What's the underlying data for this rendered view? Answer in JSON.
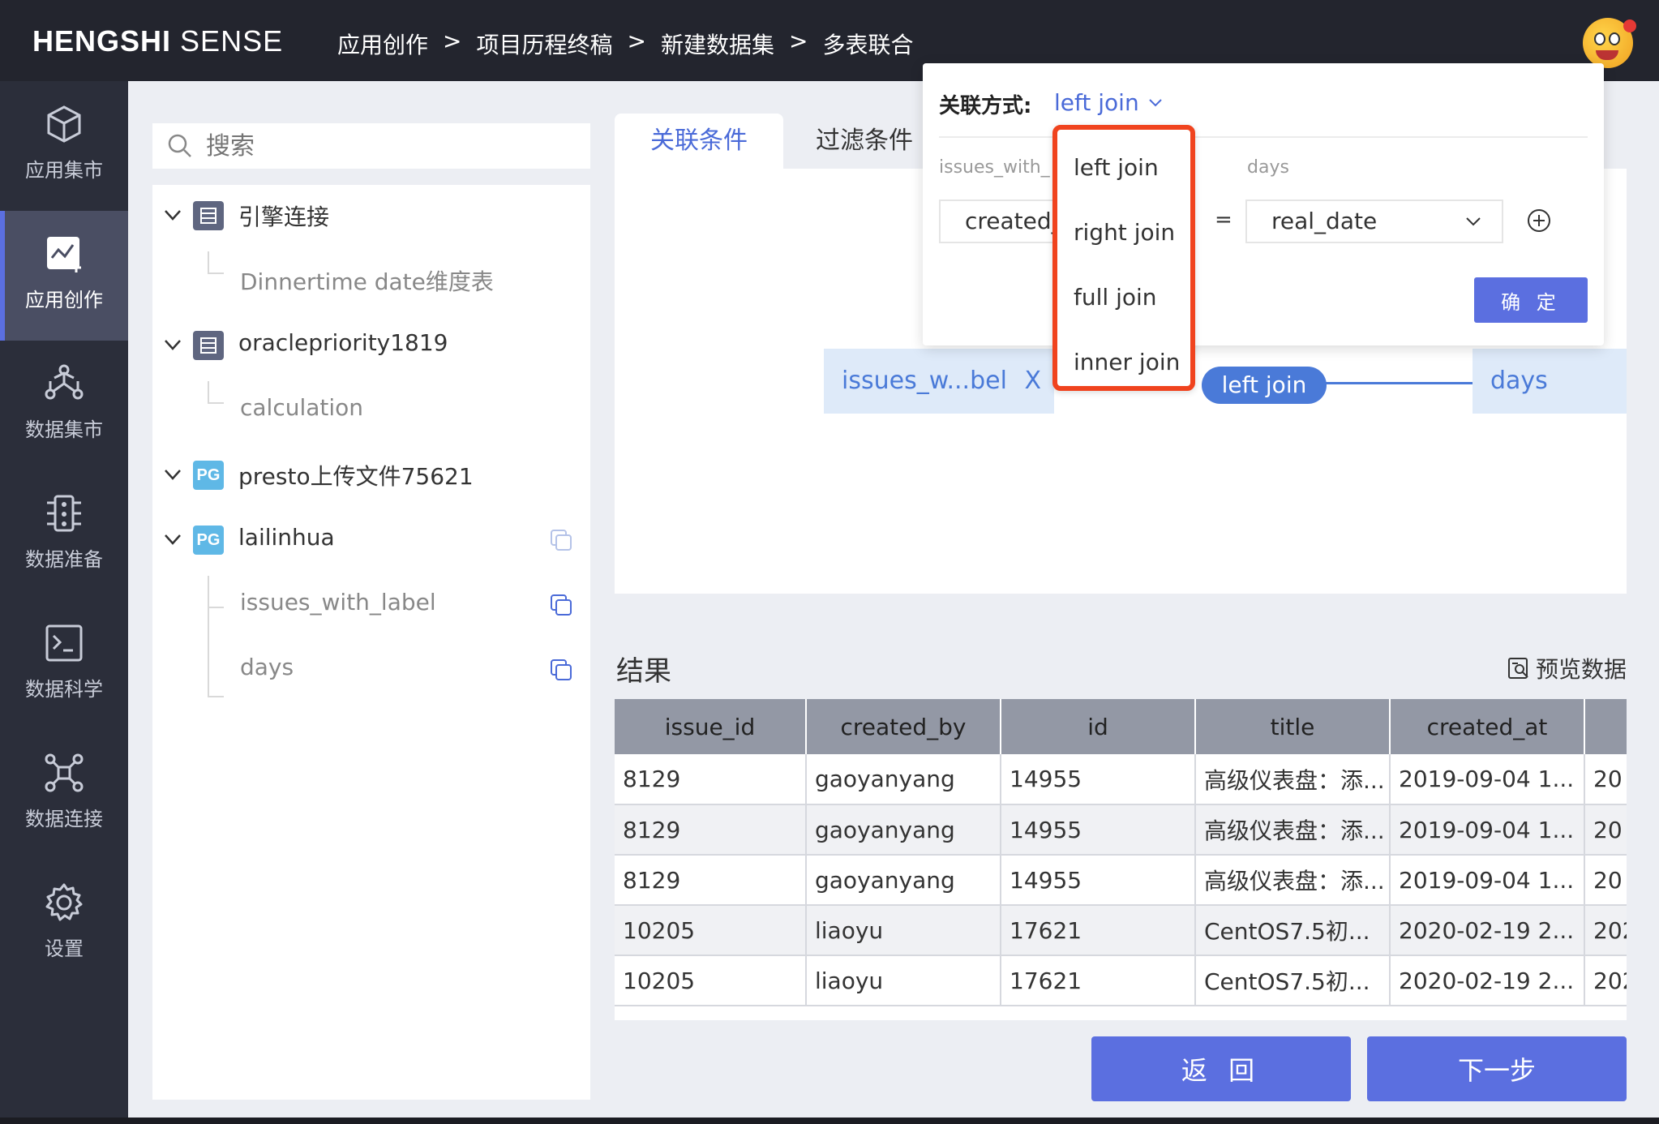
{
  "header": {
    "brand_bold": "HENGSHI",
    "brand_light": "SENSE",
    "breadcrumbs": [
      "应用创作",
      "项目历程终稿",
      "新建数据集",
      "多表联合"
    ],
    "sep": ">"
  },
  "sidebar": {
    "items": [
      {
        "label": "应用集市",
        "icon": "cube-icon"
      },
      {
        "label": "应用创作",
        "icon": "chart-add-icon"
      },
      {
        "label": "数据集市",
        "icon": "network-icon"
      },
      {
        "label": "数据准备",
        "icon": "sliders-icon"
      },
      {
        "label": "数据科学",
        "icon": "terminal-icon"
      },
      {
        "label": "数据连接",
        "icon": "connect-icon"
      },
      {
        "label": "设置",
        "icon": "gear-icon"
      }
    ],
    "active_index": 1
  },
  "search": {
    "placeholder": "搜索"
  },
  "tree": {
    "nodes": [
      {
        "name": "引擎连接",
        "type": "engine"
      },
      {
        "name": "Dinnertime date维度表",
        "type": "child"
      },
      {
        "name": "oraclepriority1819",
        "type": "engine"
      },
      {
        "name": "calculation",
        "type": "child"
      },
      {
        "name": "presto上传文件75621",
        "type": "pg"
      },
      {
        "name": "lailinhua",
        "type": "pg"
      },
      {
        "name": "issues_with_label",
        "type": "child"
      },
      {
        "name": "days",
        "type": "child"
      }
    ],
    "pg_badge": "PG"
  },
  "tabs": {
    "active": "关联条件",
    "inactive": "过滤条件"
  },
  "canvas": {
    "left_node": "issues_w...bel",
    "left_node_close": "X",
    "right_node": "days",
    "join_label": "left join"
  },
  "popover": {
    "label": "关联方式:",
    "join_type": "left join",
    "left_table": "issues_with_",
    "right_table": "days",
    "left_field": "created_",
    "eq": "=",
    "right_field": "real_date",
    "confirm": "确 定"
  },
  "dropdown": {
    "options": [
      "left join",
      "right join",
      "full join",
      "inner join"
    ]
  },
  "results": {
    "title": "结果",
    "preview": "预览数据",
    "columns": [
      "issue_id",
      "created_by",
      "id",
      "title",
      "created_at",
      ""
    ],
    "rows": [
      [
        "8129",
        "gaoyanyang",
        "14955",
        "高级仪表盘：添...",
        "2019-09-04 1...",
        "20"
      ],
      [
        "8129",
        "gaoyanyang",
        "14955",
        "高级仪表盘：添...",
        "2019-09-04 1...",
        "20"
      ],
      [
        "8129",
        "gaoyanyang",
        "14955",
        "高级仪表盘：添...",
        "2019-09-04 1...",
        "20"
      ],
      [
        "10205",
        "liaoyu",
        "17621",
        "CentOS7.5初...",
        "2020-02-19 2...",
        "202"
      ],
      [
        "10205",
        "liaoyu",
        "17621",
        "CentOS7.5初...",
        "2020-02-19 2...",
        "202"
      ]
    ]
  },
  "footer": {
    "back": "返 回",
    "next": "下一步"
  },
  "colors": {
    "accent": "#5b6fe0",
    "link": "#4a6ad8",
    "highlight_border": "#f0431e",
    "sidebar_bg": "#2b2e3a",
    "header_bg": "#23252e"
  }
}
